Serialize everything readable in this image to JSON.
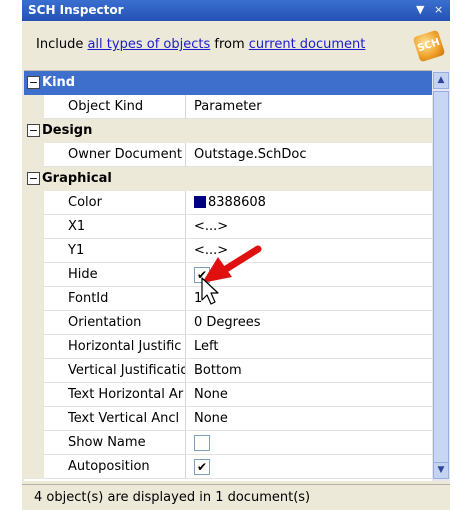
{
  "titlebar": {
    "title": "SCH Inspector",
    "menu_glyph": "▼",
    "close_glyph": "×"
  },
  "filter": {
    "prefix": "Include ",
    "scope_link": "all types of objects",
    "middle": " from ",
    "source_link": "current document",
    "icon": "filter-funnel-icon"
  },
  "categories": [
    {
      "name": "Kind",
      "toggle": "−"
    },
    {
      "name": "Design",
      "toggle": "−"
    },
    {
      "name": "Graphical",
      "toggle": "−"
    }
  ],
  "properties": {
    "object_kind": {
      "label": "Object Kind",
      "value": "Parameter"
    },
    "owner_document": {
      "label": "Owner Document",
      "value": "Outstage.SchDoc"
    },
    "color": {
      "label": "Color",
      "value": "8388608",
      "swatch": "#000080"
    },
    "x1": {
      "label": "X1",
      "value": "<...>"
    },
    "y1": {
      "label": "Y1",
      "value": "<...>"
    },
    "hide": {
      "label": "Hide",
      "checked": true,
      "check_glyph": "✔"
    },
    "font_id": {
      "label": "FontId",
      "value": "1"
    },
    "orientation": {
      "label": "Orientation",
      "value": "0 Degrees"
    },
    "horizontal_justification": {
      "label": "Horizontal Justific",
      "value": "Left"
    },
    "vertical_justification": {
      "label": "Vertical Justificatio",
      "value": "Bottom"
    },
    "text_horizontal_anchor": {
      "label": "Text Horizontal Ar",
      "value": "None"
    },
    "text_vertical_anchor": {
      "label": "Text Vertical Ancl",
      "value": "None"
    },
    "show_name": {
      "label": "Show Name",
      "checked": false,
      "check_glyph": ""
    },
    "autoposition": {
      "label": "Autoposition",
      "checked": true,
      "check_glyph": "✔"
    }
  },
  "status": "4 object(s) are displayed in 1 document(s)",
  "colors": {
    "title_bar": "#2451b5",
    "selected_category": "#3e6fcc",
    "link": "#1c1ccc",
    "annotation_arrow": "#e01010"
  },
  "icons": {
    "scroll_up": "▲",
    "scroll_down": "▼"
  }
}
